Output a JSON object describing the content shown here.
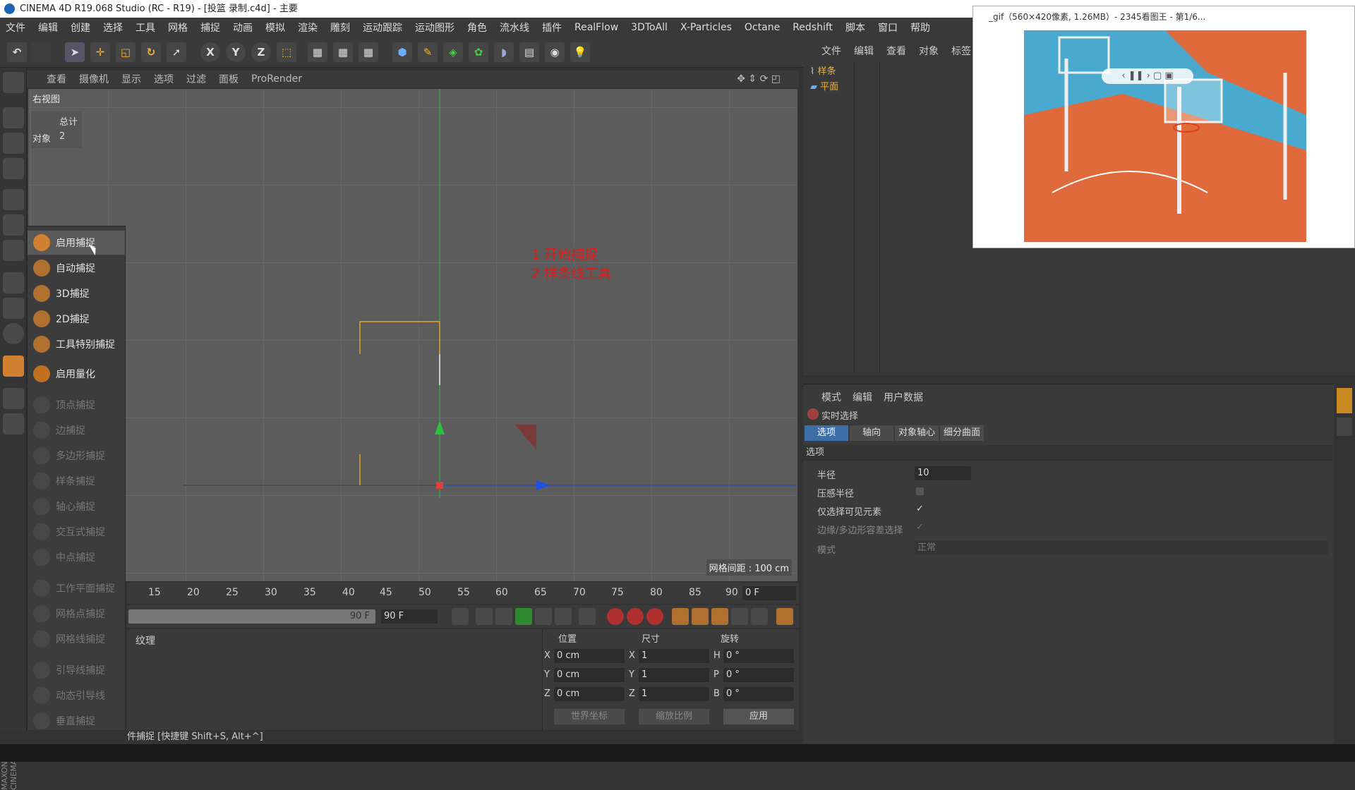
{
  "window_title": "CINEMA 4D R19.068 Studio (RC - R19) - [投篮 录制.c4d] - 主要",
  "menu": [
    "文件",
    "编辑",
    "创建",
    "选择",
    "工具",
    "网格",
    "捕捉",
    "动画",
    "模拟",
    "渲染",
    "雕刻",
    "运动跟踪",
    "运动图形",
    "角色",
    "流水线",
    "插件",
    "RealFlow",
    "3DToAll",
    "X-Particles",
    "Octane",
    "Redshift",
    "脚本",
    "窗口",
    "帮助"
  ],
  "toolbar": {
    "x": "X",
    "y": "Y",
    "z": "Z"
  },
  "viewport": {
    "menu": [
      "查看",
      "摄像机",
      "显示",
      "选项",
      "过滤",
      "面板",
      "ProRender"
    ],
    "name": "右视图",
    "info_total": "总计",
    "info_obj_label": "对象",
    "info_obj_value": "2",
    "grid_spacing": "网格间距 : 100 cm",
    "annotation_1": "1 开始捕捉",
    "annotation_2": "2 样条线工具"
  },
  "snap_menu": [
    {
      "label": "启用捕捉",
      "enabled": true
    },
    {
      "label": "自动捕捉",
      "enabled": true
    },
    {
      "label": "3D捕捉",
      "enabled": true
    },
    {
      "label": "2D捕捉",
      "enabled": true
    },
    {
      "label": "工具特别捕捉",
      "enabled": true
    },
    {
      "label": "启用量化",
      "enabled": true
    },
    {
      "label": "顶点捕捉",
      "enabled": false
    },
    {
      "label": "边捕捉",
      "enabled": false
    },
    {
      "label": "多边形捕捉",
      "enabled": false
    },
    {
      "label": "样条捕捉",
      "enabled": false
    },
    {
      "label": "轴心捕捉",
      "enabled": false
    },
    {
      "label": "交互式捕捉",
      "enabled": false
    },
    {
      "label": "中点捕捉",
      "enabled": false
    },
    {
      "label": "工作平面捕捉",
      "enabled": false
    },
    {
      "label": "网格点捕捉",
      "enabled": false
    },
    {
      "label": "网格线捕捉",
      "enabled": false
    },
    {
      "label": "引导线捕捉",
      "enabled": false
    },
    {
      "label": "动态引导线",
      "enabled": false
    },
    {
      "label": "垂直捕捉",
      "enabled": false
    }
  ],
  "timeline": {
    "ticks": [
      "15",
      "20",
      "25",
      "30",
      "35",
      "40",
      "45",
      "50",
      "55",
      "60",
      "65",
      "70",
      "75",
      "80",
      "85",
      "90"
    ],
    "current": "0 F",
    "end_a": "90 F",
    "end_b": "90 F"
  },
  "bottom": {
    "texture_label": "纹理"
  },
  "coords": {
    "pos": "位置",
    "size": "尺寸",
    "rot": "旋转",
    "x": "X",
    "y": "Y",
    "z": "Z",
    "h": "H",
    "p": "P",
    "b": "B",
    "pos_x": "0 cm",
    "pos_y": "0 cm",
    "pos_z": "0 cm",
    "size_x": "1",
    "size_y": "1",
    "size_z": "1",
    "rot_h": "0 °",
    "rot_p": "0 °",
    "rot_b": "0 °",
    "world": "世界坐标",
    "scale": "缩放比例",
    "apply": "应用"
  },
  "status": "件捕捉 [快捷键 Shift+S, Alt+^]",
  "object_manager": {
    "menu": [
      "文件",
      "编辑",
      "查看",
      "对象",
      "标签"
    ],
    "objects": [
      "样条",
      "平面"
    ]
  },
  "attributes": {
    "menu": [
      "模式",
      "编辑",
      "用户数据"
    ],
    "title": "实时选择",
    "tabs": [
      "选项",
      "轴向",
      "对象轴心",
      "细分曲面"
    ],
    "section": "选项",
    "radius_label": "半径",
    "radius_value": "10",
    "pressure_label": "压感半径",
    "visible_label": "仅选择可见元素",
    "tolerance_label": "边缘/多边形容差选择",
    "mode_label": "模式",
    "mode_value": "正常"
  },
  "gif_window": {
    "title": "_gif（560×420像素, 1.26MB）- 2345看图王 - 第1/6..."
  },
  "maxon": "MAXON CINEMA 4D",
  "colors": {
    "accent": "#e31a1a",
    "orange": "#e0a030",
    "axis_green": "#2ec040",
    "axis_blue": "#2050e0"
  }
}
